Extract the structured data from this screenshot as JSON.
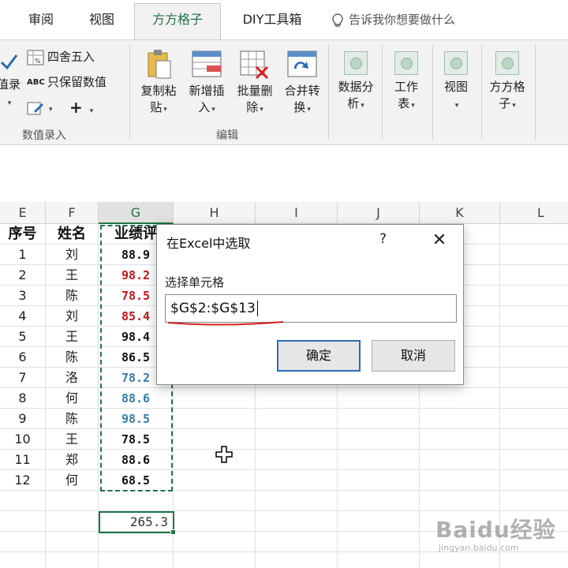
{
  "ribbon_tabs": [
    "审阅",
    "视图",
    "方方格子",
    "DIY工具箱"
  ],
  "active_tab": "方方格子",
  "tell_me": "告诉我你想要做什么",
  "ribbon": {
    "left_partial_button": "值录",
    "round_label": "四舍五入",
    "keep_value_label": "只保留数值",
    "group_value_entry": "数值录入",
    "copy_paste": [
      "复制粘",
      "贴"
    ],
    "insert_new": [
      "新增插",
      "入"
    ],
    "batch_delete": [
      "批量删",
      "除"
    ],
    "merge_convert": [
      "合并转",
      "换"
    ],
    "group_edit": "编辑",
    "data_analysis": [
      "数据分",
      "析"
    ],
    "worksheet": [
      "工作",
      "表"
    ],
    "view": [
      "视图",
      ""
    ],
    "fangfang": [
      "方方格",
      "子"
    ],
    "plus": "+"
  },
  "columns": [
    "E",
    "F",
    "G",
    "H",
    "I",
    "J",
    "K",
    "L"
  ],
  "header_row": {
    "seq": "序号",
    "name": "姓名",
    "score": "业绩评"
  },
  "rows": [
    {
      "seq": "1",
      "name": "刘",
      "score": "88.9"
    },
    {
      "seq": "2",
      "name": "王",
      "score": "98.2"
    },
    {
      "seq": "3",
      "name": "陈",
      "score": "78.5"
    },
    {
      "seq": "4",
      "name": "刘",
      "score": "85.4"
    },
    {
      "seq": "5",
      "name": "王",
      "score": "98.4"
    },
    {
      "seq": "6",
      "name": "陈",
      "score": "86.5"
    },
    {
      "seq": "7",
      "name": "洛",
      "score": "78.2"
    },
    {
      "seq": "8",
      "name": "何",
      "score": "88.6"
    },
    {
      "seq": "9",
      "name": "陈",
      "score": "98.5"
    },
    {
      "seq": "10",
      "name": "王",
      "score": "78.5"
    },
    {
      "seq": "11",
      "name": "郑",
      "score": "88.6"
    },
    {
      "seq": "12",
      "name": "何",
      "score": "68.5"
    }
  ],
  "score_colors": [
    "#111111",
    "#c0161a",
    "#c0161a",
    "#c0161a",
    "#111111",
    "#111111",
    "#3a7ca5",
    "#3a7ca5",
    "#3a7ca5",
    "#111111",
    "#111111",
    "#111111"
  ],
  "sum_value": "265.3",
  "dialog": {
    "title": "在Excel中选取",
    "help": "?",
    "close": "✕",
    "label": "选择单元格",
    "value": "$G$2:$G$13",
    "ok": "确定",
    "cancel": "取消"
  },
  "watermark": {
    "brand": "Baidu经验",
    "url": "jingyan.baidu.com"
  },
  "colors": {
    "accent": "#217346",
    "focus_blue": "#2b6cb0",
    "underline_red": "#d81e1e"
  }
}
